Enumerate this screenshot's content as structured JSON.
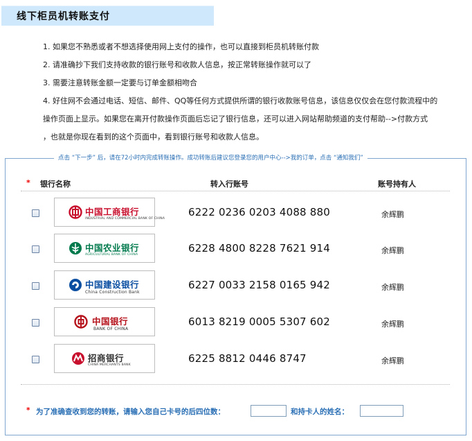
{
  "header": {
    "title": "线下柜员机转账支付"
  },
  "instructions": [
    "1. 如果您不熟悉或者不想选择使用网上支付的操作，也可以直接到柜员机转账付款",
    "2. 请准确抄下我们支持收款的银行账号和收款人信息，按正常转账操作就可以了",
    "3. 需要注意转账金额一定要与订单金额相吻合",
    "4. 好住网不会通过电话、短信、邮件、QQ等任何方式提供所谓的银行收款账号信息，该信息仅仅会在您付款流程中的",
    "操作页面上显示。如果您在离开付款操作页面后忘记了银行信息，还可以进入网站帮助频道的支付帮助-->付款方式",
    "，也就是你现在看到的这个页面中，看到银行账号和收款人信息。"
  ],
  "panel": {
    "legend": "点击 “下一步” 后，请在72小时内完成转账操作。成功转账后建议您登录您的用户中心-->我的订单，点击 “通知我们”",
    "columns": {
      "required_mark": "*",
      "bank": "银行名称",
      "account": "转入行账号",
      "holder": "账号持有人"
    }
  },
  "banks": [
    {
      "name_cn": "中国工商银行",
      "name_en": "INDUSTRIAL AND COMMERCIAL BANK OF CHINA",
      "account": "6222 0236 0203 4088 880",
      "holder": "余辉鹏",
      "color": "#c8102e",
      "icon": "icbc-logo-icon"
    },
    {
      "name_cn": "中国农业银行",
      "name_en": "AGRICULTURAL BANK OF CHINA",
      "account": "6228 4800 8228 7621 914",
      "holder": "余辉鹏",
      "color": "#007a4d",
      "icon": "abc-logo-icon"
    },
    {
      "name_cn": "中国建设银行",
      "name_en": "China Construction Bank",
      "account": "6227 0033 2158 0165 942",
      "holder": "余辉鹏",
      "color": "#0a4ea2",
      "icon": "ccb-logo-icon"
    },
    {
      "name_cn": "中国银行",
      "name_en": "BANK OF CHINA",
      "account": "6013 8219 0005 5307 602",
      "holder": "余辉鹏",
      "color": "#b5121b",
      "icon": "boc-logo-icon"
    },
    {
      "name_cn": "招商银行",
      "name_en": "CHINA MERCHANTS BANK",
      "account": "6225 8812 0446 8747",
      "holder": "余辉鹏",
      "color": "#c8102e",
      "icon": "cmb-logo-icon"
    }
  ],
  "form": {
    "required_mark": "*",
    "prompt_card": "为了准确查收到您的转账，请输入您自己卡号的后四位数：",
    "card_last4_value": "",
    "prompt_name": "和持卡人的姓名：",
    "holder_name_value": ""
  }
}
